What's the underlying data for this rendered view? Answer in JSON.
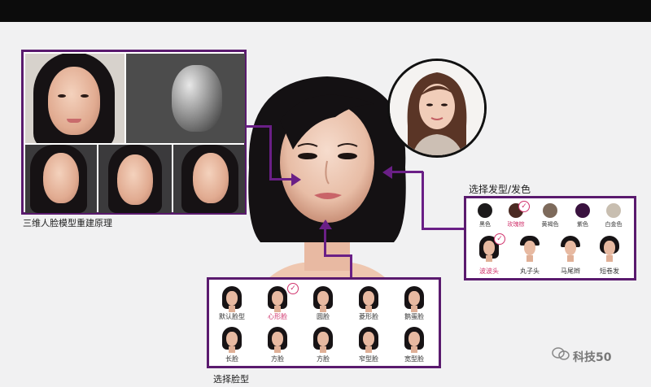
{
  "captions": {
    "recon": "三维人脸模型重建原理",
    "hair_title": "选择发型/发色",
    "face_title": "选择脸型"
  },
  "hair_colors": [
    {
      "label": "黑色",
      "color": "#1c1a1b",
      "selected": false
    },
    {
      "label": "玫瑰棕",
      "color": "#4a2a22",
      "selected": true
    },
    {
      "label": "黄褐色",
      "color": "#7d6a5b",
      "selected": false
    },
    {
      "label": "紫色",
      "color": "#3a123f",
      "selected": false
    },
    {
      "label": "白金色",
      "color": "#c8beb0",
      "selected": false
    }
  ],
  "hair_styles": [
    {
      "label": "波波头",
      "selected": true
    },
    {
      "label": "丸子头",
      "selected": false
    },
    {
      "label": "马尾辫",
      "selected": false
    },
    {
      "label": "短卷发",
      "selected": false
    }
  ],
  "face_shapes_row1": [
    {
      "label": "默认脸型",
      "selected": false
    },
    {
      "label": "心形脸",
      "selected": true
    },
    {
      "label": "圆脸",
      "selected": false
    },
    {
      "label": "菱形脸",
      "selected": false
    },
    {
      "label": "鹅蛋脸",
      "selected": false
    }
  ],
  "face_shapes_row2": [
    {
      "label": "长脸",
      "selected": false
    },
    {
      "label": "方脸",
      "selected": false
    },
    {
      "label": "方脸",
      "selected": false
    },
    {
      "label": "窄型脸",
      "selected": false
    },
    {
      "label": "宽型脸",
      "selected": false
    }
  ],
  "watermark": "科技50",
  "colors": {
    "accent": "#5a1a6e",
    "selected_text": "#d0336c"
  }
}
